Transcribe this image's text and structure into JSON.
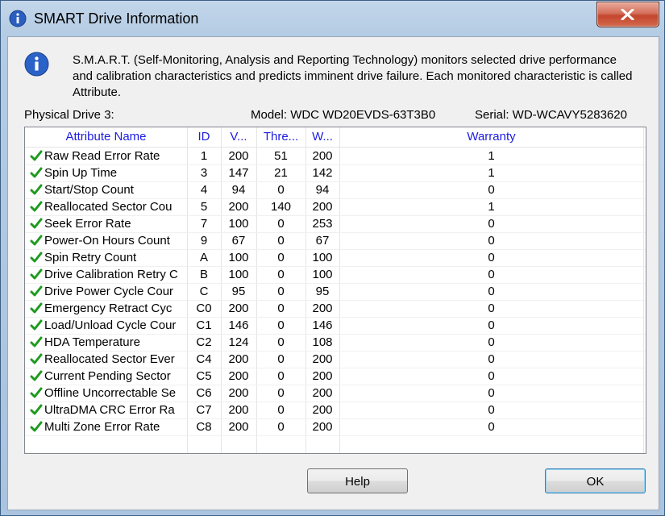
{
  "window": {
    "title": "SMART Drive Information"
  },
  "info": {
    "description": "S.M.A.R.T. (Self-Monitoring, Analysis and Reporting Technology) monitors selected drive performance and calibration characteristics and predicts imminent drive failure. Each monitored characteristic is called Attribute."
  },
  "drive": {
    "physical": "Physical Drive 3:",
    "model": "Model: WDC WD20EVDS-63T3B0",
    "serial": "Serial: WD-WCAVY5283620"
  },
  "columns": {
    "name": "Attribute Name",
    "id": "ID",
    "value": "V...",
    "threshold": "Thre...",
    "worst": "W...",
    "warranty": "Warranty"
  },
  "rows": [
    {
      "name": "Raw Read Error Rate",
      "id": "1",
      "value": "200",
      "threshold": "51",
      "worst": "200",
      "warranty": "1"
    },
    {
      "name": "Spin Up Time",
      "id": "3",
      "value": "147",
      "threshold": "21",
      "worst": "142",
      "warranty": "1"
    },
    {
      "name": "Start/Stop Count",
      "id": "4",
      "value": "94",
      "threshold": "0",
      "worst": "94",
      "warranty": "0"
    },
    {
      "name": "Reallocated Sector Cou",
      "id": "5",
      "value": "200",
      "threshold": "140",
      "worst": "200",
      "warranty": "1"
    },
    {
      "name": "Seek Error Rate",
      "id": "7",
      "value": "100",
      "threshold": "0",
      "worst": "253",
      "warranty": "0"
    },
    {
      "name": "Power-On Hours Count",
      "id": "9",
      "value": "67",
      "threshold": "0",
      "worst": "67",
      "warranty": "0"
    },
    {
      "name": "Spin Retry Count",
      "id": "A",
      "value": "100",
      "threshold": "0",
      "worst": "100",
      "warranty": "0"
    },
    {
      "name": "Drive Calibration Retry C",
      "id": "B",
      "value": "100",
      "threshold": "0",
      "worst": "100",
      "warranty": "0"
    },
    {
      "name": "Drive Power Cycle Cour",
      "id": "C",
      "value": "95",
      "threshold": "0",
      "worst": "95",
      "warranty": "0"
    },
    {
      "name": "Emergency Retract Cyc",
      "id": "C0",
      "value": "200",
      "threshold": "0",
      "worst": "200",
      "warranty": "0"
    },
    {
      "name": "Load/Unload Cycle Cour",
      "id": "C1",
      "value": "146",
      "threshold": "0",
      "worst": "146",
      "warranty": "0"
    },
    {
      "name": "HDA Temperature",
      "id": "C2",
      "value": "124",
      "threshold": "0",
      "worst": "108",
      "warranty": "0"
    },
    {
      "name": "Reallocated Sector Ever",
      "id": "C4",
      "value": "200",
      "threshold": "0",
      "worst": "200",
      "warranty": "0"
    },
    {
      "name": "Current Pending Sector",
      "id": "C5",
      "value": "200",
      "threshold": "0",
      "worst": "200",
      "warranty": "0"
    },
    {
      "name": "Offline Uncorrectable Se",
      "id": "C6",
      "value": "200",
      "threshold": "0",
      "worst": "200",
      "warranty": "0"
    },
    {
      "name": "UltraDMA CRC Error Ra",
      "id": "C7",
      "value": "200",
      "threshold": "0",
      "worst": "200",
      "warranty": "0"
    },
    {
      "name": "Multi Zone Error Rate",
      "id": "C8",
      "value": "200",
      "threshold": "0",
      "worst": "200",
      "warranty": "0"
    }
  ],
  "buttons": {
    "help": "Help",
    "ok": "OK"
  },
  "icons": {
    "title": "info-icon",
    "status": "check-icon",
    "close": "close-icon"
  },
  "colors": {
    "header_text": "#1c1ce0",
    "check": "#1e9a1e",
    "close_button": "#c4452d"
  }
}
